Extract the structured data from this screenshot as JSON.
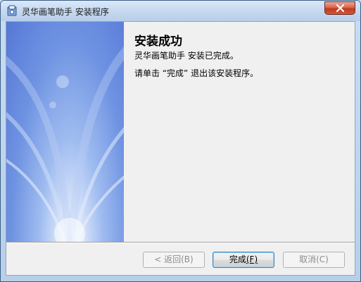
{
  "window": {
    "title": "灵华画笔助手 安装程序",
    "icon": "installer-icon",
    "close_icon": "close-icon"
  },
  "content": {
    "heading": "安装成功",
    "line1": "灵华画笔助手  安装已完成。",
    "line2": "请单击 “完成” 退出该安装程序。"
  },
  "buttons": {
    "back": {
      "label": "< 返回",
      "hotkey": "(B)",
      "enabled": false
    },
    "finish": {
      "label": "完成",
      "hotkey": "(F)",
      "enabled": true,
      "default": true
    },
    "cancel": {
      "label": "取消",
      "hotkey": "(C)",
      "enabled": false
    }
  },
  "colors": {
    "close_button": "#c1391c",
    "banner_blue": "#5577d6"
  }
}
